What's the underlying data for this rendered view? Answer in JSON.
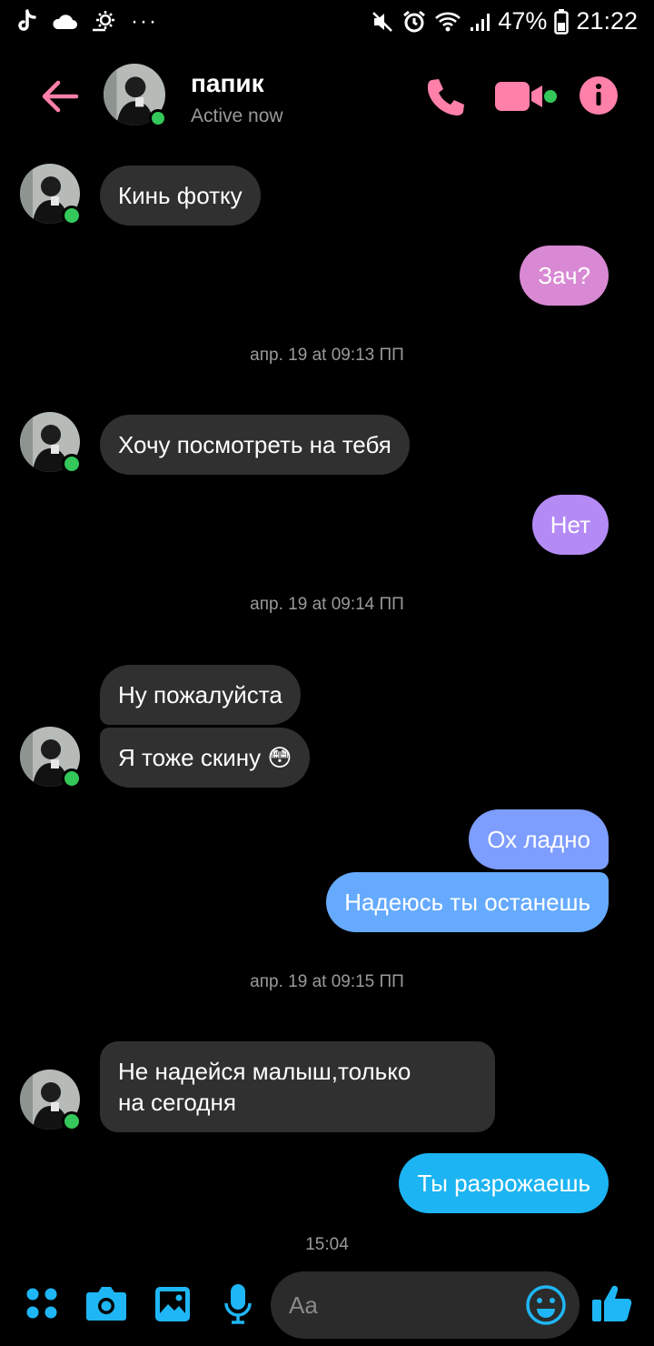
{
  "status": {
    "battery": "47%",
    "time": "21:22",
    "left_icons": [
      "tiktok-icon",
      "cloud-icon",
      "weather-icon",
      "more-notifications-icon"
    ],
    "right_icons": [
      "mute-icon",
      "alarm-icon",
      "wifi-icon",
      "signal-icon",
      "battery-icon"
    ]
  },
  "header": {
    "name": "папик",
    "presence": "Active now",
    "accent": "#ff80a8",
    "icons": [
      "back-arrow-icon",
      "phone-icon",
      "video-camera-icon",
      "info-icon"
    ]
  },
  "messages": [
    {
      "dir": "in",
      "text": "Кинь фотку"
    },
    {
      "dir": "out",
      "text": "Зач?",
      "color": "#d989d4"
    },
    {
      "ts": "апр. 19 at 09:13 ПП"
    },
    {
      "dir": "in",
      "text": "Хочу посмотреть на тебя"
    },
    {
      "dir": "out",
      "text": "Нет",
      "color": "#b48af5"
    },
    {
      "ts": "апр. 19 at 09:14 ПП"
    },
    {
      "dir": "in",
      "text": "Ну пожалуйста"
    },
    {
      "dir": "in",
      "text": "Я тоже скину 😳"
    },
    {
      "dir": "out",
      "text": "Ох ладно",
      "color": "#7d9dff"
    },
    {
      "dir": "out",
      "text": "Надеюсь ты останешь",
      "color": "#65aaff"
    },
    {
      "ts": "апр. 19 at 09:15 ПП"
    },
    {
      "dir": "in",
      "text_line1": "Не надейся малыш,только",
      "text_line2": "на сегодня"
    },
    {
      "dir": "out",
      "text": "Ты разрожаешь",
      "color": "#1cb4f2"
    },
    {
      "ts": "15:04"
    }
  ],
  "composer": {
    "placeholder": "Aa",
    "accent": "#1fb6f5",
    "icons": [
      "apps-grid-icon",
      "camera-icon",
      "gallery-icon",
      "microphone-icon",
      "emoji-icon",
      "thumbs-up-icon"
    ]
  }
}
